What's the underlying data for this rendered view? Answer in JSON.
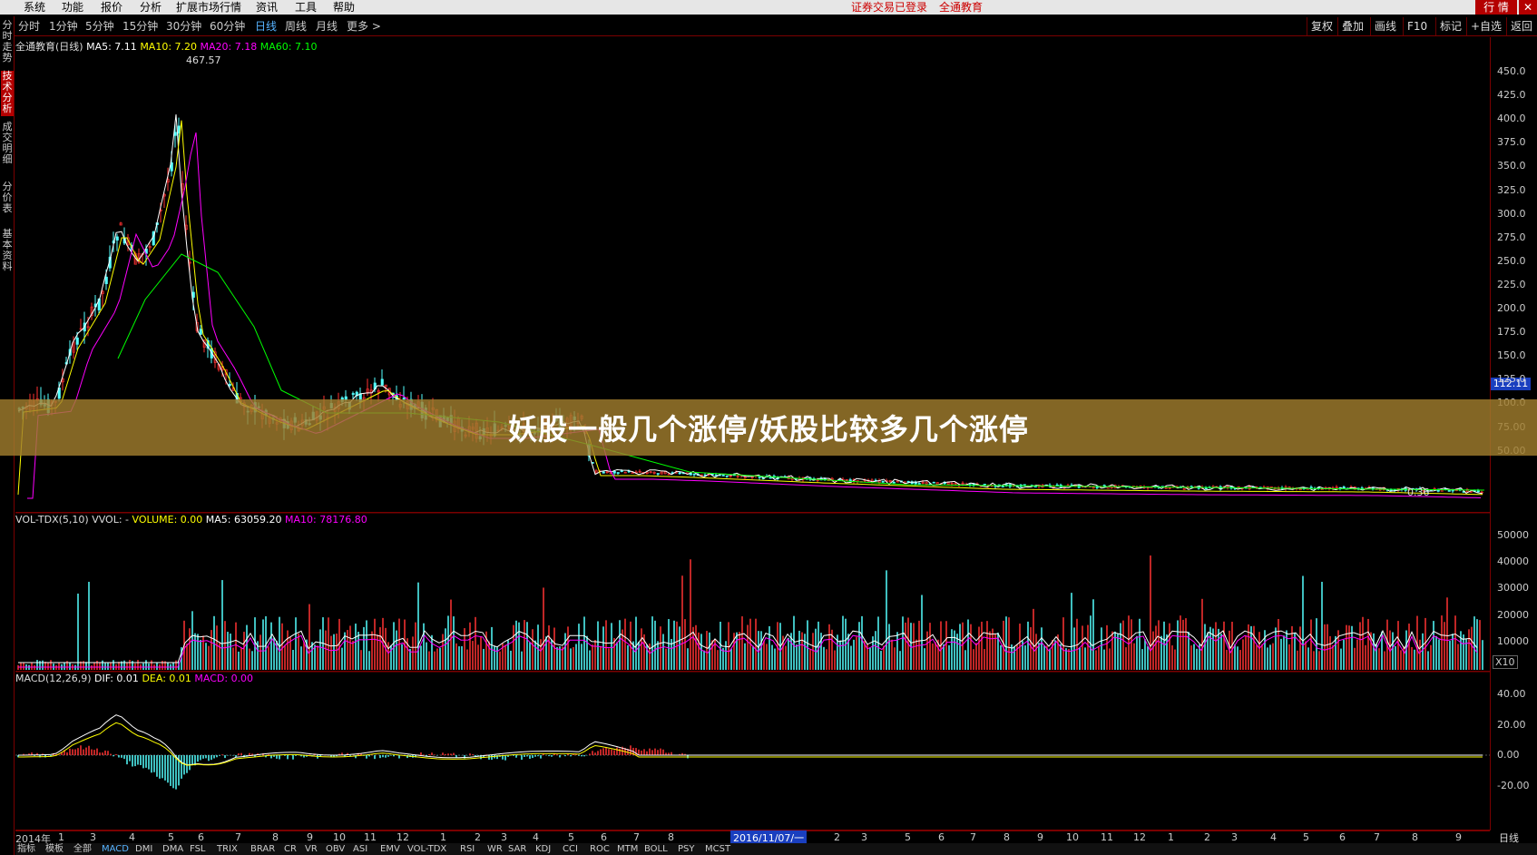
{
  "menu": {
    "items": [
      "系统",
      "功能",
      "报价",
      "分析",
      "扩展市场行情",
      "资讯",
      "工具",
      "帮助"
    ],
    "notice1": "证券交易已登录",
    "notice2": "全通教育",
    "hq": "行 情",
    "close": "✕"
  },
  "toolbar": {
    "periods": [
      "分时",
      "1分钟",
      "5分钟",
      "15分钟",
      "30分钟",
      "60分钟",
      "日线",
      "周线",
      "月线",
      "更多 >"
    ],
    "right_buttons": [
      "复权",
      "叠加",
      "画线",
      "F10",
      "标记",
      "+自选",
      "返回"
    ]
  },
  "side_tabs": [
    "分时走势",
    "技术分析",
    "成交明细",
    "分价表",
    "基本资料"
  ],
  "price_panel": {
    "legend": {
      "name": "全通教育(日线)",
      "ma5": "MA5: 7.11",
      "ma10": "MA10: 7.20",
      "ma20": "MA20: 7.18",
      "ma60": "MA60: 7.10"
    },
    "high_label": "467.57",
    "low_label": "0.36",
    "current_price": "112.11",
    "yticks": [
      "450.0",
      "425.0",
      "400.0",
      "375.0",
      "350.0",
      "325.0",
      "300.0",
      "275.0",
      "250.0",
      "225.0",
      "200.0",
      "175.0",
      "150.0",
      "125.0",
      "100.0",
      "75.00",
      "50.00"
    ]
  },
  "volume_panel": {
    "legend": {
      "name": "VOL-TDX(5,10)",
      "vvol": "VVOL: -",
      "volume": "VOLUME: 0.00",
      "ma5": "MA5: 63059.20",
      "ma10": "MA10: 78176.80"
    },
    "yticks": [
      "50000",
      "40000",
      "30000",
      "20000",
      "10000"
    ],
    "multiplier": "X10"
  },
  "macd_panel": {
    "legend": {
      "name": "MACD(12,26,9)",
      "dif": "DIF: 0.01",
      "dea": "DEA: 0.01",
      "macd": "MACD: 0.00"
    },
    "yticks": [
      "40.00",
      "20.00",
      "0.00",
      "-20.00"
    ]
  },
  "date_axis": {
    "labels": [
      "2014年",
      "1",
      "3",
      "4",
      "5",
      "6",
      "7",
      "8",
      "9",
      "10",
      "11",
      "12",
      "1",
      "2",
      "3",
      "4",
      "5",
      "6",
      "7",
      "8",
      "1",
      "2",
      "3",
      "5",
      "6",
      "7",
      "8",
      "9",
      "10",
      "11",
      "12",
      "1",
      "2",
      "3",
      "4",
      "5",
      "6",
      "7",
      "8",
      "9"
    ],
    "cursor_date": "2016/11/07/一",
    "period": "日线"
  },
  "bottom_tabs": [
    "指标",
    "模板",
    "全部",
    "MACD",
    "DMI",
    "DMA",
    "FSL",
    "TRIX",
    "BRAR",
    "CR",
    "VR",
    "OBV",
    "ASI",
    "EMV",
    "VOL-TDX",
    "RSI",
    "WR",
    "SAR",
    "KDJ",
    "CCI",
    "ROC",
    "MTM",
    "BOLL",
    "PSY",
    "MCST"
  ],
  "banner": {
    "text": "妖股一般几个涨停/妖股比较多几个涨停"
  },
  "colors": {
    "up": "#ff3232",
    "down": "#54ffff",
    "ma5": "#ffffff",
    "ma10": "#ffff00",
    "ma20": "#ff00ff",
    "ma60": "#00ff00",
    "grid": "#7a0000"
  }
}
